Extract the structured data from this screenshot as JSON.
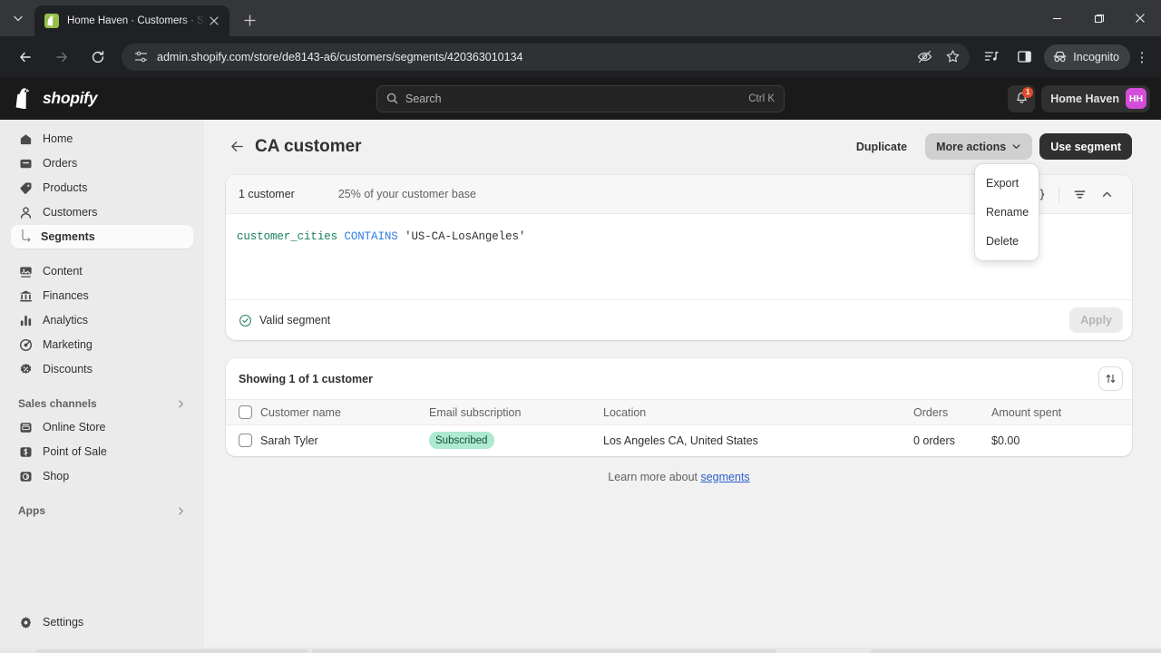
{
  "browser": {
    "tab": {
      "title": "Home Haven · Customers · Sho",
      "favicon": "shopify-icon",
      "close_label": "×"
    },
    "new_tab_label": "+",
    "window": {
      "minimize": "−",
      "maximize": "❐",
      "close": "✕"
    },
    "nav": {
      "back": "←",
      "forward": "→",
      "reload": "⟳"
    },
    "url": "admin.shopify.com/store/de8143-a6/customers/segments/420363010134",
    "profile_label": "Incognito",
    "menu_label": "⋮"
  },
  "topbar": {
    "brand": "shopify",
    "search": {
      "placeholder": "Search",
      "shortcut": "Ctrl K"
    },
    "notifications_count": "1",
    "store_name": "Home Haven",
    "avatar_initials": "HH"
  },
  "sidebar": {
    "items": [
      {
        "label": "Home",
        "icon": "home-icon"
      },
      {
        "label": "Orders",
        "icon": "orders-icon"
      },
      {
        "label": "Products",
        "icon": "tag-icon"
      },
      {
        "label": "Customers",
        "icon": "person-icon"
      }
    ],
    "sub_item": {
      "label": "Segments",
      "icon": "elbow-icon"
    },
    "items2": [
      {
        "label": "Content",
        "icon": "content-icon"
      },
      {
        "label": "Finances",
        "icon": "bank-icon"
      },
      {
        "label": "Analytics",
        "icon": "bar-chart-icon"
      },
      {
        "label": "Marketing",
        "icon": "target-icon"
      },
      {
        "label": "Discounts",
        "icon": "discount-icon"
      }
    ],
    "sales_channels": {
      "label": "Sales channels",
      "chevron": "›"
    },
    "channels": [
      {
        "label": "Online Store",
        "icon": "storefront-icon"
      },
      {
        "label": "Point of Sale",
        "icon": "pos-icon"
      },
      {
        "label": "Shop",
        "icon": "shop-icon"
      }
    ],
    "apps": {
      "label": "Apps",
      "chevron": "›"
    },
    "settings": {
      "label": "Settings",
      "icon": "gear-icon"
    }
  },
  "page": {
    "title": "CA customer",
    "back_icon": "arrow-left-icon",
    "actions": {
      "duplicate": "Duplicate",
      "more_actions": "More actions",
      "use_segment": "Use segment"
    },
    "dropdown": {
      "items": [
        "Export",
        "Rename",
        "Delete"
      ]
    }
  },
  "segment_card": {
    "customer_count": "1 customer",
    "base_percent": "25% of your customer base",
    "tools": [
      "revert-icon",
      "braces-icon",
      "filter-icon",
      "collapse-icon"
    ],
    "query": {
      "field": "customer_cities",
      "operator": "CONTAINS",
      "value": "'US-CA-LosAngeles'"
    },
    "status": "Valid segment",
    "apply_label": "Apply"
  },
  "table_card": {
    "title": "Showing 1 of 1 customer",
    "sort_icon": "sort-icon",
    "columns": [
      "Customer name",
      "Email subscription",
      "Location",
      "Orders",
      "Amount spent"
    ],
    "rows": [
      {
        "name": "Sarah Tyler",
        "email_subscription": "Subscribed",
        "location": "Los Angeles CA, United States",
        "orders": "0 orders",
        "amount_spent": "$0.00"
      }
    ]
  },
  "footer": {
    "text": "Learn more about ",
    "link": "segments"
  },
  "colors": {
    "accent": "#303030",
    "avatar": "#d44dd8",
    "badge_bg": "#aee9d1",
    "badge_text": "#0f5132",
    "query_field": "#1a7f5a",
    "query_operator": "#2f7de1",
    "valid": "#2e8a62",
    "link": "#2c5ecf",
    "notification_badge": "#e04b2a"
  }
}
